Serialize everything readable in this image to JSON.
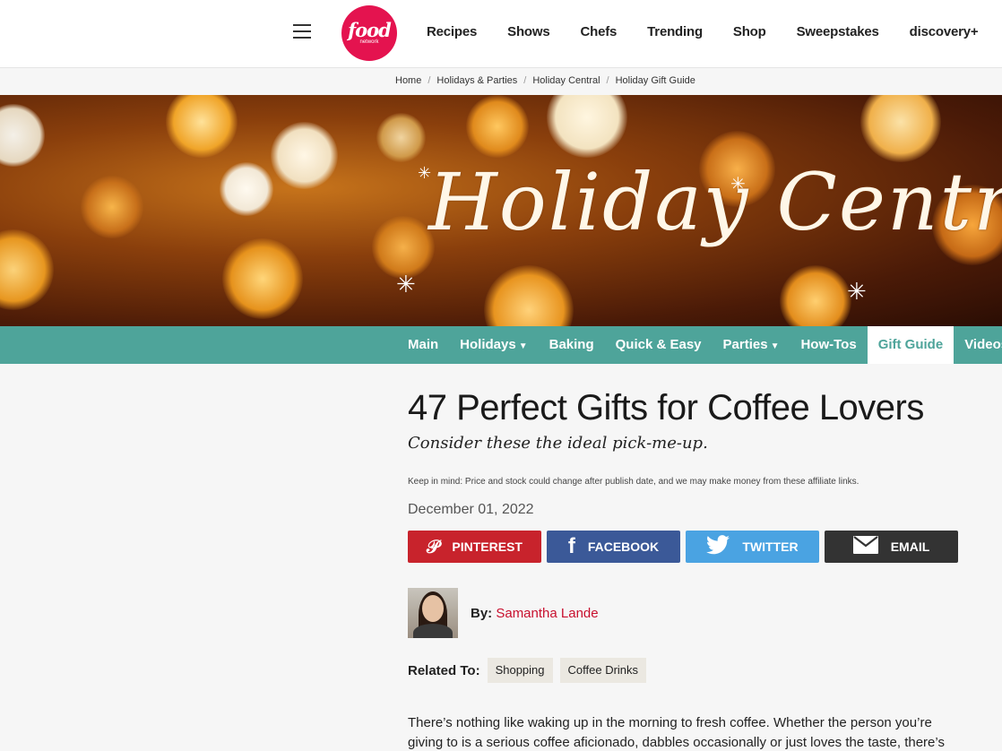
{
  "header": {
    "logo_text": "food",
    "logo_sub": "network",
    "nav": [
      "Recipes",
      "Shows",
      "Chefs",
      "Trending",
      "Shop",
      "Sweepstakes",
      "discovery+"
    ]
  },
  "breadcrumb": [
    "Home",
    "Holidays & Parties",
    "Holiday Central",
    "Holiday Gift Guide"
  ],
  "banner": {
    "title": "Holiday Central"
  },
  "subnav": {
    "items": [
      "Main",
      "Holidays",
      "Baking",
      "Quick & Easy",
      "Parties",
      "How-Tos",
      "Gift Guide",
      "Videos"
    ],
    "active": "Gift Guide"
  },
  "article": {
    "title": "47 Perfect Gifts for Coffee Lovers",
    "subtitle": "Consider these the ideal pick-me-up.",
    "disclaimer": "Keep in mind: Price and stock could change after publish date, and we may make money from these affiliate links.",
    "date": "December 01, 2022",
    "share": {
      "pinterest": "PINTEREST",
      "facebook": "FACEBOOK",
      "twitter": "TWITTER",
      "email": "EMAIL"
    },
    "byline_label": "By:",
    "author": "Samantha Lande",
    "related_label": "Related To:",
    "tags": [
      "Shopping",
      "Coffee Drinks"
    ],
    "body": "There’s nothing like waking up in the morning to fresh coffee. Whether the person you’re giving to is a serious coffee aficionado, dabbles occasionally or just loves the taste, there’s"
  },
  "colors": {
    "brand": "#e4134f",
    "subnav": "#4ea49a",
    "pinterest": "#c8232c",
    "facebook": "#3b5998",
    "twitter": "#4aa3e2",
    "email": "#333333",
    "author_link": "#c8102e"
  }
}
